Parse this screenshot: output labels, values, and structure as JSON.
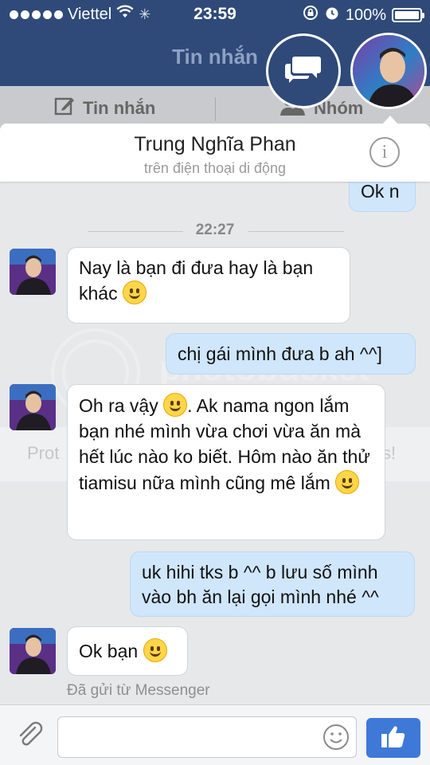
{
  "status_bar": {
    "carrier": "Viettel",
    "time": "23:59",
    "battery": "100%"
  },
  "nav": {
    "title": "Tin nhắn",
    "tabs": [
      {
        "label": "Tin nhắn",
        "icon": "compose-icon"
      },
      {
        "label": "Nhóm",
        "icon": "group-icon"
      }
    ]
  },
  "conversation": {
    "contact_name": "Trung Nghĩa Phan",
    "contact_subtitle": "trên điện thoại di động",
    "timestamp": "22:27",
    "messages": [
      {
        "from": "me",
        "text": "Ok n"
      },
      {
        "from": "them",
        "text": "Nay là bạn đi đưa hay là bạn khác",
        "emoji": "smile"
      },
      {
        "from": "me",
        "text": "chị gái mình đưa b ah ^^]"
      },
      {
        "from": "them",
        "text_before": "Oh ra vậy",
        "text_after": ". Ak nama ngon lắm bạn nhé mình vừa chơi vừa ăn mà hết lúc nào ko biết. Hôm nào ăn thử tiamisu nữa mình cũng mê lắm",
        "emoji": "grin"
      },
      {
        "from": "me",
        "text": "uk hihi tks b ^^ b lưu số mình vào bh ăn lại gọi mình nhé ^^"
      },
      {
        "from": "them",
        "text": "Ok bạn",
        "emoji": "grin"
      }
    ],
    "sent_note": "Đã gửi từ Messenger"
  },
  "watermark": {
    "logo_text": "photobucket",
    "band_left": "Prot",
    "band_right": "s!"
  },
  "composer": {
    "placeholder": ""
  },
  "colors": {
    "nav_bg": "#2f4a79",
    "outgoing_bubble": "#cfe6fb",
    "incoming_bubble": "#ffffff",
    "like_button": "#3e79d8"
  }
}
